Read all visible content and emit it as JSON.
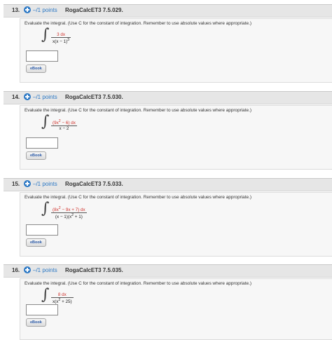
{
  "questions": [
    {
      "number": "13.",
      "points": "–/1 points",
      "code": "RogaCalcET3 7.5.029.",
      "instruction": "Evaluate the integral. (Use C for the constant of integration. Remember to use absolute values where appropriate.)",
      "numerator": "3 dx",
      "denominator": "x(x − 1)",
      "denominator_sup": "3",
      "numerator_color": "red",
      "ebook_label": "eBook",
      "answer_value": ""
    },
    {
      "number": "14.",
      "points": "–/1 points",
      "code": "RogaCalcET3 7.5.030.",
      "instruction": "Evaluate the integral. (Use C for the constant of integration. Remember to use absolute values where appropriate.)",
      "numerator": "(9x",
      "numerator_sup": "2",
      "numerator_tail": " − 6) dx",
      "denominator": "x − 2",
      "ebook_label": "eBook",
      "answer_value": ""
    },
    {
      "number": "15.",
      "points": "–/1 points",
      "code": "RogaCalcET3 7.5.033.",
      "instruction": "Evaluate the integral. (Use C for the constant of integration. Remember to use absolute values where appropriate.)",
      "numerator": "(8x",
      "numerator_sup": "2",
      "numerator_tail": " − 9x + 7) dx",
      "denominator": "(x − 1)(x",
      "denominator_sup": "2",
      "denominator_tail": " + 1)",
      "ebook_label": "eBook",
      "answer_value": ""
    },
    {
      "number": "16.",
      "points": "–/1 points",
      "code": "RogaCalcET3 7.5.035.",
      "instruction": "Evaluate the integral. (Use C for the constant of integration. Remember to use absolute values where appropriate.)",
      "numerator": "8 dx",
      "denominator": "x(x",
      "denominator_sup": "2",
      "denominator_tail": " + 25)",
      "ebook_label": "eBook",
      "answer_value": ""
    }
  ],
  "colors": {
    "accent": "#2b78c5",
    "highlight": "#d0302a",
    "header_bg": "#e6e6e6"
  },
  "icons": {
    "points": "plus-circle-icon",
    "integral": "integral-sign"
  }
}
